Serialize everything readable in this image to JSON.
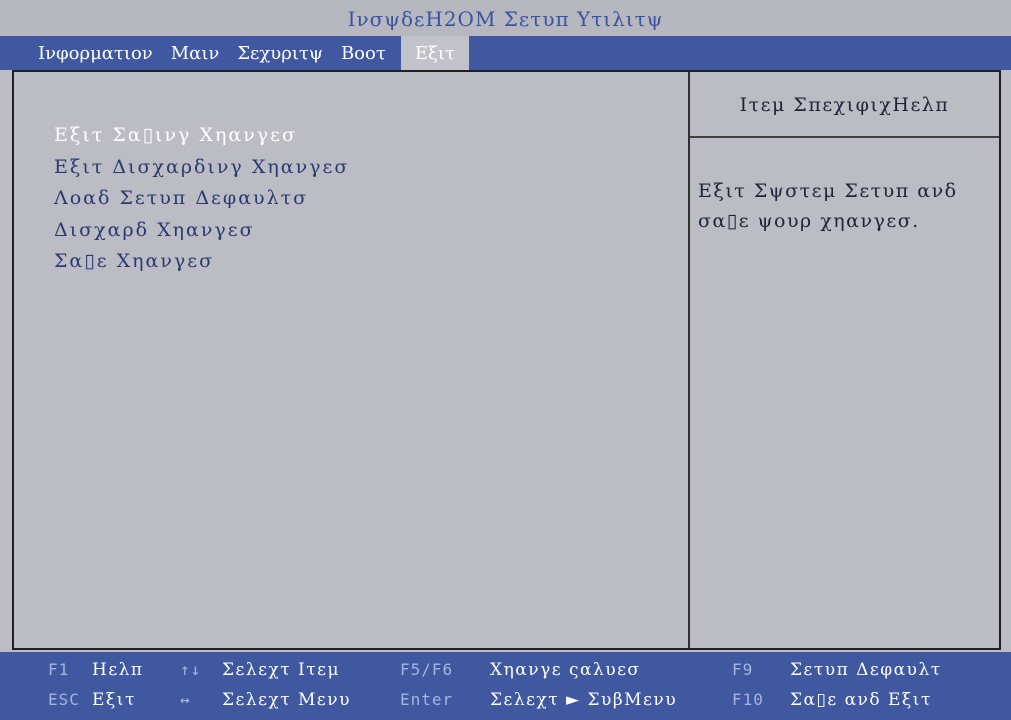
{
  "title": "ΙνσψδεΗ2ΟΜ Σετυπ Υτιλιτψ",
  "menu": {
    "items": [
      {
        "label": "Ινφορματιον",
        "active": false
      },
      {
        "label": "Μαιν",
        "active": false
      },
      {
        "label": "Σεχυριτψ",
        "active": false
      },
      {
        "label": "Βοοτ",
        "active": false
      },
      {
        "label": "Εξιτ",
        "active": true
      }
    ]
  },
  "exit_menu": {
    "options": [
      "Εξιτ Σα▯ινγ Χηανγεσ",
      "Εξιτ Δισχαρδινγ Χηανγεσ",
      "Λοαδ Σετυπ Δεφαυλτσ",
      "Δισχαρδ Χηανγεσ",
      "Σα▯ε Χηανγεσ"
    ],
    "selected_index": 0
  },
  "help": {
    "title": "Ιτεμ ΣπεχιφιχΗελπ",
    "lines": [
      "Εξιτ Σψστεμ Σετυπ ανδ",
      "σα▯ε ψουρ χηανγεσ."
    ]
  },
  "footer": {
    "keys": [
      {
        "key": "F1",
        "label": "Ηελπ"
      },
      {
        "key": "ESC",
        "label": "Εξιτ"
      },
      {
        "key": "↑↓",
        "label": "Σελεχτ Ιτεμ"
      },
      {
        "key": "↔",
        "label": "Σελεχτ Μενυ"
      },
      {
        "key": "F5/F6",
        "label": "Χηανγε ςαλυεσ"
      },
      {
        "key": "Enter",
        "label": "Σελεχτ ► ΣυβΜενυ"
      },
      {
        "key": "F9",
        "label": "Σετυπ Δεφαυλτ"
      },
      {
        "key": "F10",
        "label": "Σα▯ε ανδ Εξιτ"
      }
    ]
  },
  "colors": {
    "background": "#bcbcc4",
    "menu_bar": "#3f58a0",
    "title_text": "#3854a0",
    "option_text": "#2a3a70",
    "selected_option": "#ffffff",
    "key_text": "#a8b4e0"
  }
}
